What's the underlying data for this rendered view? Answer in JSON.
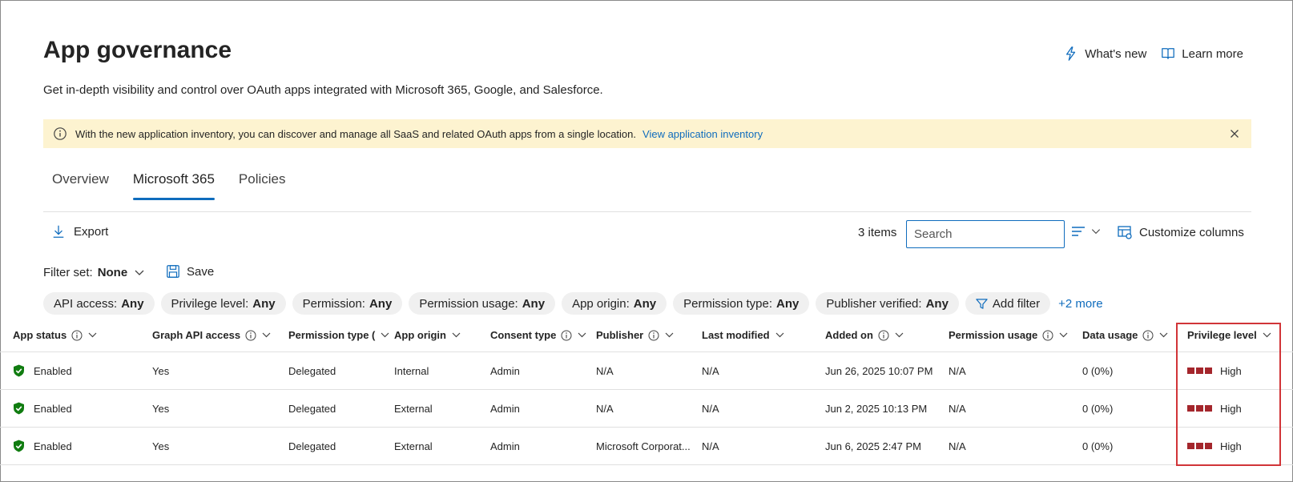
{
  "header": {
    "title": "App governance",
    "subtitle": "Get in-depth visibility and control over OAuth apps integrated with Microsoft 365, Google, and Salesforce.",
    "whats_new": "What's new",
    "learn_more": "Learn more"
  },
  "banner": {
    "text": "With the new application inventory, you can discover and manage all SaaS and related OAuth apps from a single location.",
    "link": "View application inventory",
    "color": "#fdf3d0"
  },
  "tabs": [
    {
      "label": "Overview",
      "active": false
    },
    {
      "label": "Microsoft 365",
      "active": true
    },
    {
      "label": "Policies",
      "active": false
    }
  ],
  "toolbar": {
    "export_label": "Export",
    "items_count": "3 items",
    "search_placeholder": "Search",
    "customize_label": "Customize columns"
  },
  "filterset": {
    "label": "Filter set:",
    "value": "None",
    "save_label": "Save"
  },
  "filters": [
    {
      "label": "API access:",
      "value": "Any"
    },
    {
      "label": "Privilege level:",
      "value": "Any"
    },
    {
      "label": "Permission:",
      "value": "Any"
    },
    {
      "label": "Permission usage:",
      "value": "Any"
    },
    {
      "label": "App origin:",
      "value": "Any"
    },
    {
      "label": "Permission type:",
      "value": "Any"
    },
    {
      "label": "Publisher verified:",
      "value": "Any"
    }
  ],
  "add_filter_label": "Add filter",
  "more_filters_label": "+2 more",
  "columns": [
    {
      "label": "App status"
    },
    {
      "label": "Graph API access"
    },
    {
      "label": "Permission type ("
    },
    {
      "label": "App origin"
    },
    {
      "label": "Consent type"
    },
    {
      "label": "Publisher"
    },
    {
      "label": "Last modified"
    },
    {
      "label": "Added on"
    },
    {
      "label": "Permission usage"
    },
    {
      "label": "Data usage"
    },
    {
      "label": "Privilege level"
    }
  ],
  "rows": [
    {
      "status": "Enabled",
      "graph": "Yes",
      "perm_type": "Delegated",
      "origin": "Internal",
      "consent": "Admin",
      "publisher": "N/A",
      "modified": "N/A",
      "added": "Jun 26, 2025 10:07 PM",
      "perm_usage": "N/A",
      "data_usage": "0 (0%)",
      "privilege": "High"
    },
    {
      "status": "Enabled",
      "graph": "Yes",
      "perm_type": "Delegated",
      "origin": "External",
      "consent": "Admin",
      "publisher": "N/A",
      "modified": "N/A",
      "added": "Jun 2, 2025 10:13 PM",
      "perm_usage": "N/A",
      "data_usage": "0 (0%)",
      "privilege": "High"
    },
    {
      "status": "Enabled",
      "graph": "Yes",
      "perm_type": "Delegated",
      "origin": "External",
      "consent": "Admin",
      "publisher": "Microsoft Corporat...",
      "modified": "N/A",
      "added": "Jun 6, 2025 2:47 PM",
      "perm_usage": "N/A",
      "data_usage": "0 (0%)",
      "privilege": "High"
    }
  ],
  "colors": {
    "accent": "#0f6cbd",
    "high_privilege": "#a4262c",
    "enabled_green": "#107c10",
    "highlight_box": "#d13438"
  }
}
